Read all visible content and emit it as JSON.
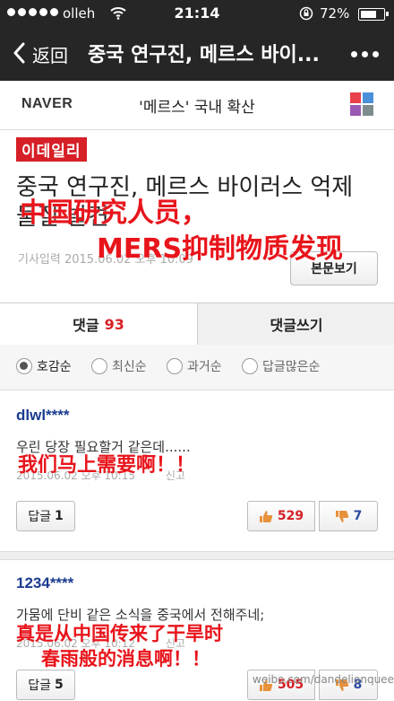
{
  "status_bar": {
    "carrier": "olleh",
    "time": "21:14",
    "battery": "72%",
    "battery_level": 0.72
  },
  "nav": {
    "back_label": "返回",
    "title": "중국 연구진, 메르스 바이..."
  },
  "naver": {
    "logo": "NAVER",
    "topic": "'메르스' 국내 확산",
    "grid_colors": [
      "#e8414b",
      "#4a90d9",
      "#9b59b6",
      "#7f8c8d"
    ]
  },
  "article": {
    "press": "이데일리",
    "headline": "중국 연구진, 메르스 바이러스 억제 물질 발견",
    "timestamp": "기사입력 2015.06.02 오후 10:09",
    "body_button": "본문보기"
  },
  "tabs": {
    "comments_label": "댓글",
    "comments_count": "93",
    "write_label": "댓글쓰기"
  },
  "sort": {
    "options": [
      "호감순",
      "최신순",
      "과거순",
      "답글많은순"
    ],
    "selected": 0
  },
  "comments": [
    {
      "user": "dlwl****",
      "text": "우린 당장 필요할거 같은데......",
      "meta": "2015.06.02 오후 10:15",
      "report": "신고",
      "reply_label": "답글",
      "reply_count": "1",
      "likes": "529",
      "dislikes": "7"
    },
    {
      "user": "1234****",
      "text": "가뭄에 단비 같은 소식을 중국에서 전해주네;",
      "meta": "2015.06.02 오후 10:12",
      "report": "신고",
      "reply_label": "답글",
      "reply_count": "5",
      "likes": "505",
      "dislikes": "8"
    }
  ],
  "captions": {
    "headline_line1": "中国研究人员，",
    "headline_line2": "MERS抑制物质发现",
    "comment1": "我们马上需要啊！！",
    "comment2_line1": "真是从中国传来了干旱时",
    "comment2_line2": "春雨般的消息啊！！"
  },
  "watermark": "weibo.com/dandelionqueen"
}
